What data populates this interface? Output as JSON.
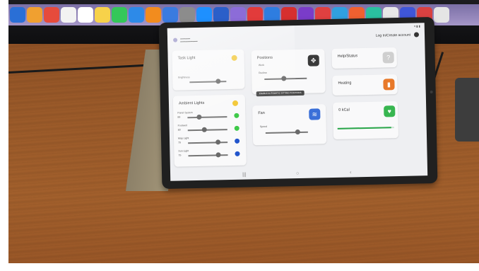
{
  "colors": {
    "bulb": "#f2c631",
    "dot_green": "#3ec949",
    "dot_blue": "#2255cc",
    "fan_blue": "#3a6fd8",
    "heating_orange": "#e8792a",
    "kcal_green": "#38b650",
    "positions_dark": "#3a3a3a"
  },
  "tablet": {
    "login_text": "Log In/Create account",
    "tooltip": "ENABLE AUTOMATIC SITTING POSITIONS",
    "cards": {
      "task_light": {
        "title": "Task Light",
        "brightness_label": "Brightness",
        "brightness_level": 0.78
      },
      "ambient_lights": {
        "title": "Ambient Lights",
        "sliders": [
          {
            "label": "Panel System",
            "value": "88",
            "level": 0.3,
            "indicator": "green"
          },
          {
            "label": "Footwell",
            "value": "80",
            "level": 0.42,
            "indicator": "green"
          },
          {
            "label": "Map Light",
            "value": "75",
            "level": 0.75,
            "indicator": "blue"
          },
          {
            "label": "Sun Light",
            "value": "75",
            "level": 0.75,
            "indicator": "blue"
          }
        ]
      },
      "positions": {
        "title": "Positions",
        "sub1": "Work",
        "sub2": "Recline",
        "level": 0.45
      },
      "help_status": {
        "title": "Help/Status"
      },
      "heating": {
        "title": "Heating"
      },
      "fan": {
        "title": "Fan",
        "speed_label": "Speed",
        "level": 0.75
      },
      "kcal": {
        "title": "0 kCal",
        "progress": 0.95
      }
    }
  }
}
